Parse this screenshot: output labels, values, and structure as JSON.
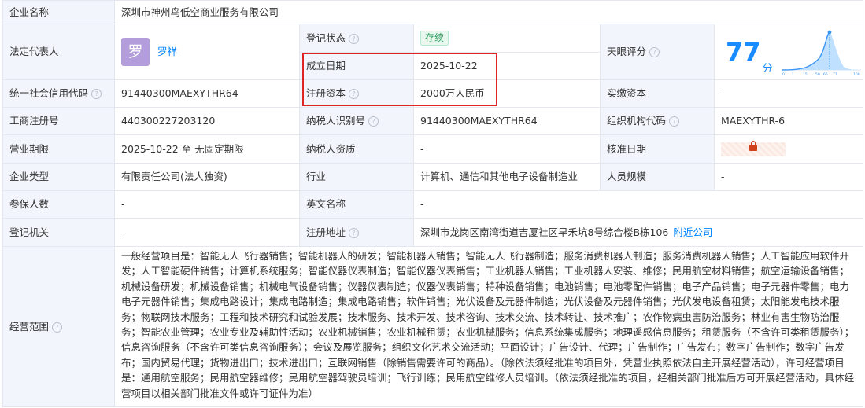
{
  "company_name": {
    "label": "企业名称",
    "value": "深圳市神州鸟低空商业服务有限公司"
  },
  "legal_rep": {
    "label": "法定代表人",
    "avatar_char": "罗",
    "name": "罗祥"
  },
  "status": {
    "label": "登记状态",
    "value": "存续"
  },
  "founded": {
    "label": "成立日期",
    "value": "2025-10-22"
  },
  "registered_capital": {
    "label": "注册资本",
    "value": "2000万人民币"
  },
  "tianyan": {
    "label": "天眼评分",
    "score": "77",
    "unit": "分",
    "axis_ticks": [
      "0",
      "1",
      "15",
      "50",
      "65",
      "77",
      "100"
    ]
  },
  "credit_code": {
    "label": "统一社会信用代码",
    "value": "91440300MAEXYTHR64"
  },
  "paid_capital": {
    "label": "实缴资本",
    "value": "-"
  },
  "reg_no": {
    "label": "工商注册号",
    "value": "440300227203120"
  },
  "taxpayer_id": {
    "label": "纳税人识别号",
    "value": "91440300MAEXYTHR64"
  },
  "org_code": {
    "label": "组织机构代码",
    "value": "MAEXYTHR-6"
  },
  "term": {
    "label": "营业期限",
    "value": "2025-10-22 至 无固定期限"
  },
  "taxpayer_qual": {
    "label": "纳税人资质",
    "value": "-"
  },
  "approval_date": {
    "label": "核准日期"
  },
  "company_type": {
    "label": "企业类型",
    "value": "有限责任公司(法人独资)"
  },
  "industry": {
    "label": "行业",
    "value": "计算机、通信和其他电子设备制造业"
  },
  "staff_size": {
    "label": "人员规模",
    "value": "-"
  },
  "insured": {
    "label": "参保人数",
    "value": "-"
  },
  "english_name": {
    "label": "英文名称",
    "value": "-"
  },
  "authority": {
    "label": "登记机关",
    "value": "-"
  },
  "address": {
    "label": "注册地址",
    "value": "深圳市龙岗区南湾街道吉厦社区早禾坑8号综合楼B栋106",
    "link": "附近公司"
  },
  "scope": {
    "label": "经营范围",
    "value": "一般经营项目是：智能无人飞行器销售；智能机器人的研发；智能机器人销售；智能无人飞行器制造；服务消费机器人制造；服务消费机器人销售；人工智能应用软件开发；人工智能硬件销售；计算机系统服务；智能仪器仪表制造；智能仪器仪表销售；工业机器人销售；工业机器人安装、维修；民用航空材料销售；航空运输设备销售；机械设备研发；机械设备销售；机械电气设备销售；仪器仪表制造；仪器仪表销售；特种设备销售；电池销售；电池零配件销售；电子产品销售；电子元器件零售；电力电子元器件销售；集成电路设计；集成电路制造；集成电路销售；软件销售；光伏设备及元器件制造；光伏设备及元器件销售；光伏发电设备租赁；太阳能发电技术服务；物联网技术服务；工程和技术研究和试验发展；技术服务、技术开发、技术咨询、技术交流、技术转让、技术推广；农作物病虫害防治服务；林业有害生物防治服务；智能农业管理；农业专业及辅助性活动；农业机械销售；农业机械租赁；农业机械服务；信息系统集成服务；地理遥感信息服务；租赁服务（不含许可类租赁服务）；信息咨询服务（不含许可类信息咨询服务）；会议及展览服务；组织文化艺术交流活动；平面设计；广告设计、代理；广告制作；广告发布；数字广告制作；数字广告发布；国内贸易代理；货物进出口；技术进出口；互联网销售（除销售需要许可的商品）。（除依法须经批准的项目外，凭营业执照依法自主开展经营活动），许可经营项目是：通用航空服务；民用航空器维修；民用航空器驾驶员培训；飞行训练；民用航空维修人员培训。（依法须经批准的项目，经相关部门批准后方可开展经营活动，具体经营项目以相关部门批准文件或许可证件为准）"
  }
}
